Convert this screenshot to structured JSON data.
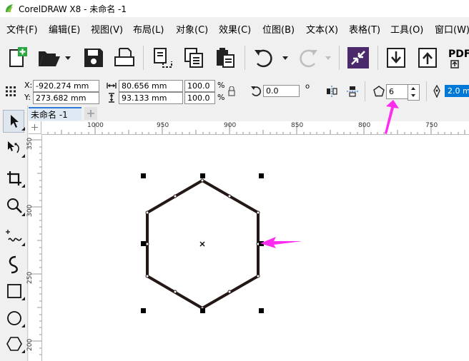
{
  "window": {
    "title": "CorelDRAW X8 - 未命名 -1"
  },
  "menu": [
    {
      "label": "文件(F)"
    },
    {
      "label": "编辑(E)"
    },
    {
      "label": "视图(V)"
    },
    {
      "label": "布局(L)"
    },
    {
      "label": "对象(C)"
    },
    {
      "label": "效果(C)"
    },
    {
      "label": "位图(B)"
    },
    {
      "label": "文本(X)"
    },
    {
      "label": "表格(T)"
    },
    {
      "label": "工具(O)"
    },
    {
      "label": "窗口(W)"
    }
  ],
  "toolbar": {
    "pdf_label": "PDF"
  },
  "propbar": {
    "x_label": "X:",
    "x_value": "-920.274 mm",
    "y_label": "Y:",
    "y_value": "273.682 mm",
    "width_value": "80.656 mm",
    "height_value": "93.133 mm",
    "scale_w": "100.0",
    "scale_h": "100.0",
    "percent": "%",
    "rotation_value": "0.0",
    "degree": "o",
    "sides_value": "6",
    "outline_value": "2.0 mm"
  },
  "document": {
    "tab_label": "未命名 -1"
  },
  "ruler_top": [
    "1000",
    "950",
    "900",
    "850",
    "800",
    "750"
  ],
  "ruler_left": [
    "350",
    "300",
    "250",
    "200"
  ],
  "colors": {
    "accent": "#2c7ad6",
    "annotation": "#ff2cf0",
    "shape_stroke": "#231815"
  }
}
